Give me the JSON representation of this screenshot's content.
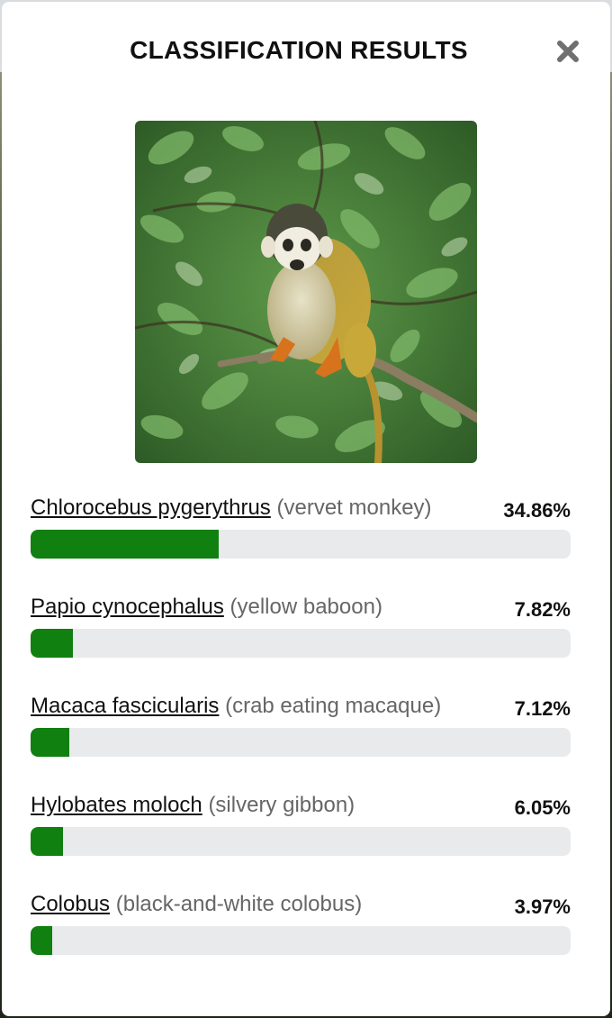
{
  "modal": {
    "title": "CLASSIFICATION RESULTS",
    "close_icon": "close-icon"
  },
  "colors": {
    "bar_fill": "#108010",
    "bar_track": "#e8eaec"
  },
  "results": [
    {
      "scientific_name": "Chlorocebus pygerythrus",
      "common_name": "(vervet monkey)",
      "percent_label": "34.86%",
      "value": 34.86
    },
    {
      "scientific_name": "Papio cynocephalus",
      "common_name": "(yellow baboon)",
      "percent_label": "7.82%",
      "value": 7.82
    },
    {
      "scientific_name": "Macaca fascicularis",
      "common_name": "(crab eating macaque)",
      "percent_label": "7.12%",
      "value": 7.12
    },
    {
      "scientific_name": "Hylobates moloch",
      "common_name": "(silvery gibbon)",
      "percent_label": "6.05%",
      "value": 6.05
    },
    {
      "scientific_name": "Colobus",
      "common_name": "(black-and-white colobus)",
      "percent_label": "3.97%",
      "value": 3.97
    }
  ]
}
